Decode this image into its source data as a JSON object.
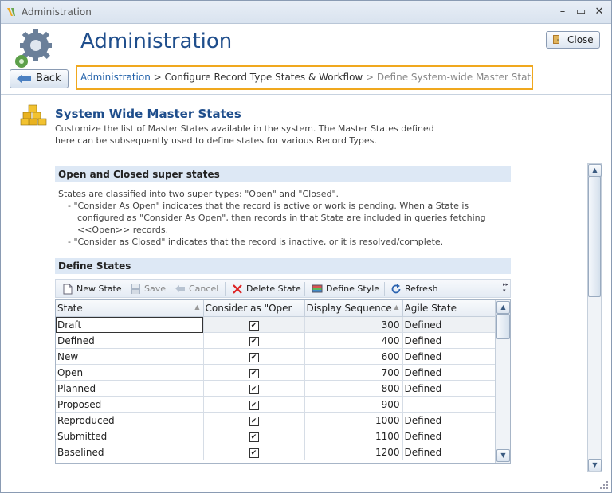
{
  "window": {
    "title": "Administration",
    "minimize_glyph": "–",
    "restore_glyph": "▭",
    "close_glyph": "✕"
  },
  "header": {
    "title": "Administration",
    "close_label": "Close",
    "back_label": "Back",
    "breadcrumb": {
      "link": "Administration",
      "separator1": " > ",
      "middle": "Configure Record Type States & Workflow",
      "separator2": " > ",
      "current": "Define System-wide Master States"
    }
  },
  "section": {
    "title": "System Wide Master States",
    "description": "Customize the list of Master States available in the system. The Master States defined here can be subsequently used to define states for various Record Types."
  },
  "super_states": {
    "heading": "Open and Closed super states",
    "line1": "States are classified into two super types: \"Open\" and \"Closed\".",
    "line2": "- \"Consider As Open\" indicates that the record is active or work is pending. When a State is",
    "line3": "configured as \"Consider As Open\", then records in that State are included in queries fetching",
    "line4": "<<Open>> records.",
    "line5": "- \"Consider as Closed\" indicates that the record is inactive, or it is resolved/complete."
  },
  "define_states": {
    "heading": "Define States",
    "toolbar": {
      "new_state": "New State",
      "save": "Save",
      "cancel": "Cancel",
      "delete_state": "Delete State",
      "define_style": "Define Style",
      "refresh": "Refresh"
    },
    "columns": [
      "State",
      "Consider as \"Oper",
      "Display Sequence",
      "Agile State"
    ],
    "rows": [
      {
        "state": "Draft",
        "open": "✔",
        "seq": "300",
        "agile": "Defined"
      },
      {
        "state": "Defined",
        "open": "✔",
        "seq": "400",
        "agile": "Defined"
      },
      {
        "state": "New",
        "open": "✔",
        "seq": "600",
        "agile": "Defined"
      },
      {
        "state": "Open",
        "open": "✔",
        "seq": "700",
        "agile": "Defined"
      },
      {
        "state": "Planned",
        "open": "✔",
        "seq": "800",
        "agile": "Defined"
      },
      {
        "state": "Proposed",
        "open": "✔",
        "seq": "900",
        "agile": ""
      },
      {
        "state": "Reproduced",
        "open": "✔",
        "seq": "1000",
        "agile": "Defined"
      },
      {
        "state": "Submitted",
        "open": "✔",
        "seq": "1100",
        "agile": "Defined"
      },
      {
        "state": "Baselined",
        "open": "✔",
        "seq": "1200",
        "agile": "Defined"
      }
    ]
  },
  "icons": {
    "app": "app-logo-icon",
    "gear": "gear-icon",
    "close": "close-door-icon",
    "back": "back-arrow-icon",
    "cubes": "cubes-icon"
  },
  "colors": {
    "accent": "#1f4e8c",
    "breadcrumb_border": "#f0a81e",
    "link": "#1f5fa8"
  }
}
